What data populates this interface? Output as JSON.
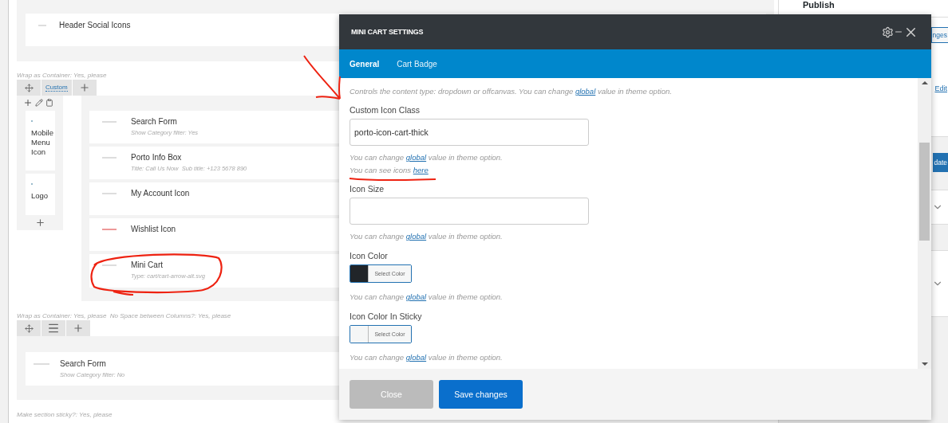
{
  "builder": {
    "top_element": {
      "title": "Header Social Icons"
    },
    "row1": {
      "meta": "Wrap as Container: Yes, please",
      "layout_label": "Custom",
      "left_elements": [
        {
          "title": "Mobile Menu Icon"
        },
        {
          "title": "Logo"
        }
      ],
      "right_elements": [
        {
          "title": "Search Form",
          "subtitle": "Show Category filter: Yes"
        },
        {
          "title": "Porto Info Box",
          "subtitle": "Title: Call Us Now  Sub title: +123 5678 890"
        },
        {
          "title": "My Account Icon"
        },
        {
          "title": "Wishlist Icon"
        },
        {
          "title": "Mini Cart",
          "subtitle": "Type: cart/cart-arrow-alt.svg"
        }
      ]
    },
    "row2": {
      "meta": "Wrap as Container: Yes, please  No Space between Columns?: Yes, please",
      "elements": [
        {
          "title": "Search Form",
          "subtitle": "Show Category filter: No"
        }
      ]
    },
    "row3": {
      "meta": "Make section sticky?: Yes, please"
    }
  },
  "sidebar": {
    "title": "Publish",
    "button": "nges",
    "link": "Edit",
    "update": "date"
  },
  "modal": {
    "title": "MINI CART SETTINGS",
    "tabs": [
      {
        "label": "General",
        "selected": true
      },
      {
        "label": "Cart Badge",
        "selected": false
      }
    ],
    "fields": [
      {
        "kind": "note",
        "hints": [
          {
            "before": "Controls the content type: dropdown or offcanvas. You can change ",
            "link": "global",
            "after": " value in theme option."
          }
        ]
      },
      {
        "kind": "text",
        "label": "Custom Icon Class",
        "value": "porto-icon-cart-thick",
        "hints": [
          {
            "before": "You can change ",
            "link": "global",
            "after": " value in theme option."
          },
          {
            "before": "You can see icons ",
            "link": "here"
          }
        ]
      },
      {
        "kind": "text",
        "label": "Icon Size",
        "hints": [
          {
            "before": "You can change ",
            "link": "global",
            "after": " value in theme option."
          }
        ]
      },
      {
        "kind": "color",
        "label": "Icon Color",
        "color": "#212529",
        "button": "Select Color",
        "hints": [
          {
            "before": "You can change ",
            "link": "global",
            "after": " value in theme option."
          }
        ]
      },
      {
        "kind": "color",
        "label": "Icon Color In Sticky",
        "color": "#f5f6f6",
        "button": "Select Color",
        "hints": [
          {
            "before": "You can change ",
            "link": "global",
            "after": " value in theme option."
          }
        ]
      }
    ],
    "buttons": [
      {
        "label": "Close",
        "kind": "secondary"
      },
      {
        "label": "Save changes",
        "kind": "primary"
      }
    ]
  }
}
